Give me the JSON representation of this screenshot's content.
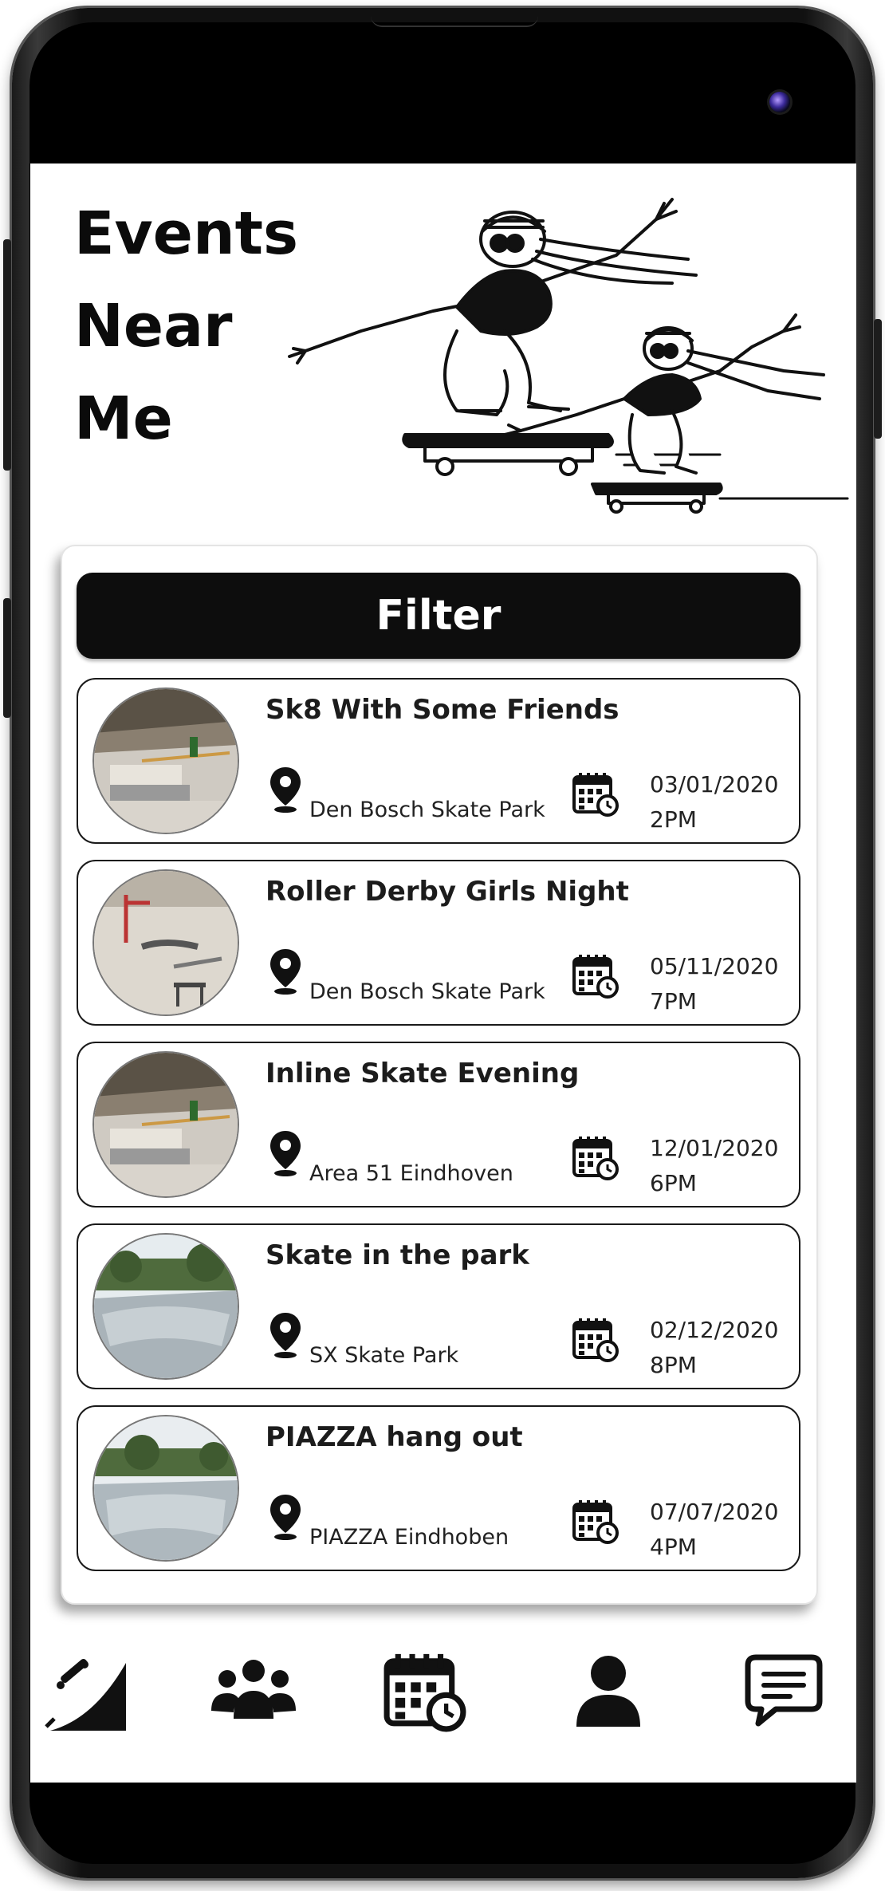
{
  "header": {
    "title_line1": "Events",
    "title_line2": "Near",
    "title_line3": "Me"
  },
  "filter": {
    "label": "Filter"
  },
  "events": [
    {
      "title": "Sk8 With Some Friends",
      "place": "Den Bosch Skate Park",
      "date": "03/01/2020",
      "time": "2PM"
    },
    {
      "title": "Roller Derby Girls Night",
      "place": "Den Bosch Skate Park",
      "date": "05/11/2020",
      "time": "7PM"
    },
    {
      "title": "Inline Skate Evening",
      "place": "Area 51 Eindhoven",
      "date": "12/01/2020",
      "time": "6PM"
    },
    {
      "title": "Skate in the park",
      "place": "SX Skate Park",
      "date": "02/12/2020",
      "time": "8PM"
    },
    {
      "title": "PIAZZA hang out",
      "place": "PIAZZA Eindhoben",
      "date": "07/07/2020",
      "time": "4PM"
    }
  ],
  "nav": {
    "items": [
      "skate-ramp-icon",
      "group-icon",
      "calendar-icon",
      "profile-icon",
      "chat-icon"
    ]
  },
  "colors": {
    "primary": "#0d0d0d",
    "background": "#ffffff"
  }
}
